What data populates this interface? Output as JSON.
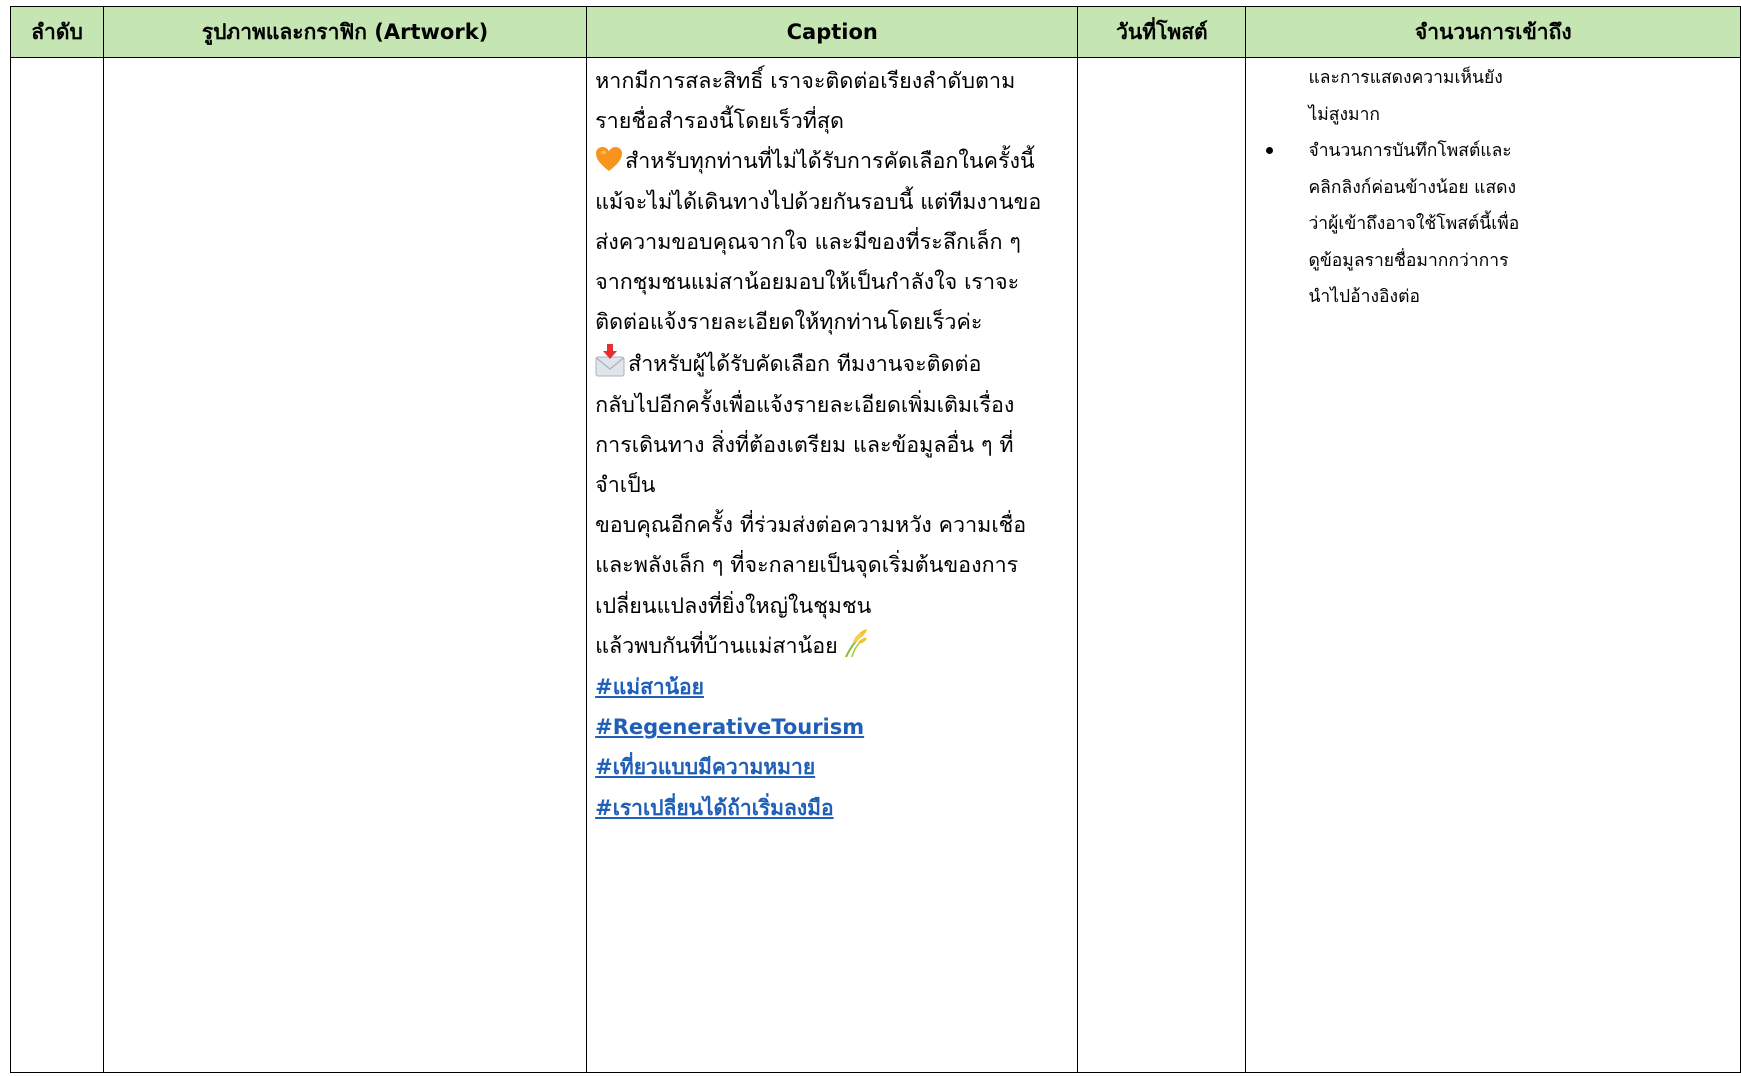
{
  "table": {
    "headers": {
      "order": "ลำดับ",
      "artwork": "รูปภาพและกราฟิก (Artwork)",
      "caption": "Caption",
      "post_date": "วันที่โพสต์",
      "access_count": "จำนวนการเข้าถึง"
    },
    "row": {
      "order": "",
      "artwork": "",
      "post_date": "",
      "caption": {
        "line_01": "หากมีการสละสิทธิ์ เราจะติดต่อเรียงลำดับตาม",
        "line_02": "รายชื่อสำรองนี้โดยเร็วที่สุด",
        "line_03": "สำหรับทุกท่านที่ไม่ได้รับการคัดเลือกในครั้งนี้",
        "line_04": "แม้จะไม่ได้เดินทางไปด้วยกันรอบนี้ แต่ทีมงานขอ",
        "line_05": "ส่งความขอบคุณจากใจ และมีของที่ระลึกเล็ก ๆ",
        "line_06": "จากชุมชนแม่สาน้อยมอบให้เป็นกำลังใจ เราจะ",
        "line_07": "ติดต่อแจ้งรายละเอียดให้ทุกท่านโดยเร็วค่ะ",
        "line_08": "สำหรับผู้ได้รับคัดเลือก ทีมงานจะติดต่อ",
        "line_09": "กลับไปอีกครั้งเพื่อแจ้งรายละเอียดเพิ่มเติมเรื่อง",
        "line_10": "การเดินทาง สิ่งที่ต้องเตรียม และข้อมูลอื่น ๆ ที่",
        "line_11": "จำเป็น",
        "line_12": "ขอบคุณอีกครั้ง ที่ร่วมส่งต่อความหวัง ความเชื่อ",
        "line_13": "และพลังเล็ก ๆ ที่จะกลายเป็นจุดเริ่มต้นของการ",
        "line_14": "เปลี่ยนแปลงที่ยิ่งใหญ่ในชุมชน",
        "line_15": "แล้วพบกันที่บ้านแม่สาน้อย",
        "icons": [
          "orange-heart-icon",
          "incoming-envelope-icon",
          "sheaf-of-rice-icon"
        ],
        "hashtags": {
          "tag_1": "#แม่สาน้อย",
          "tag_2": "#RegenerativeTourism",
          "tag_3": "#เที่ยวแบบมีความหมาย",
          "tag_4": "#เราเปลี่ยนได้ถ้าเริ่มลงมือ"
        }
      },
      "access": {
        "cont_1": "และการแสดงความเห็นยัง",
        "cont_2": "ไม่สูงมาก",
        "bullet_line_1": "จำนวนการบันทึกโพสต์และ",
        "bullet_line_2": "คลิกลิงก์ค่อนข้างน้อย แสดง",
        "bullet_line_3": "ว่าผู้เข้าถึงอาจใช้โพสต์นี้เพื่อ",
        "bullet_line_4": "ดูข้อมูลรายชื่อมากกว่าการ",
        "bullet_line_5": "นำไปอ้างอิงต่อ"
      }
    }
  },
  "colors": {
    "header_bg": "#c5e6b3",
    "hashtag": "#1f5fb8",
    "border": "#000000"
  }
}
